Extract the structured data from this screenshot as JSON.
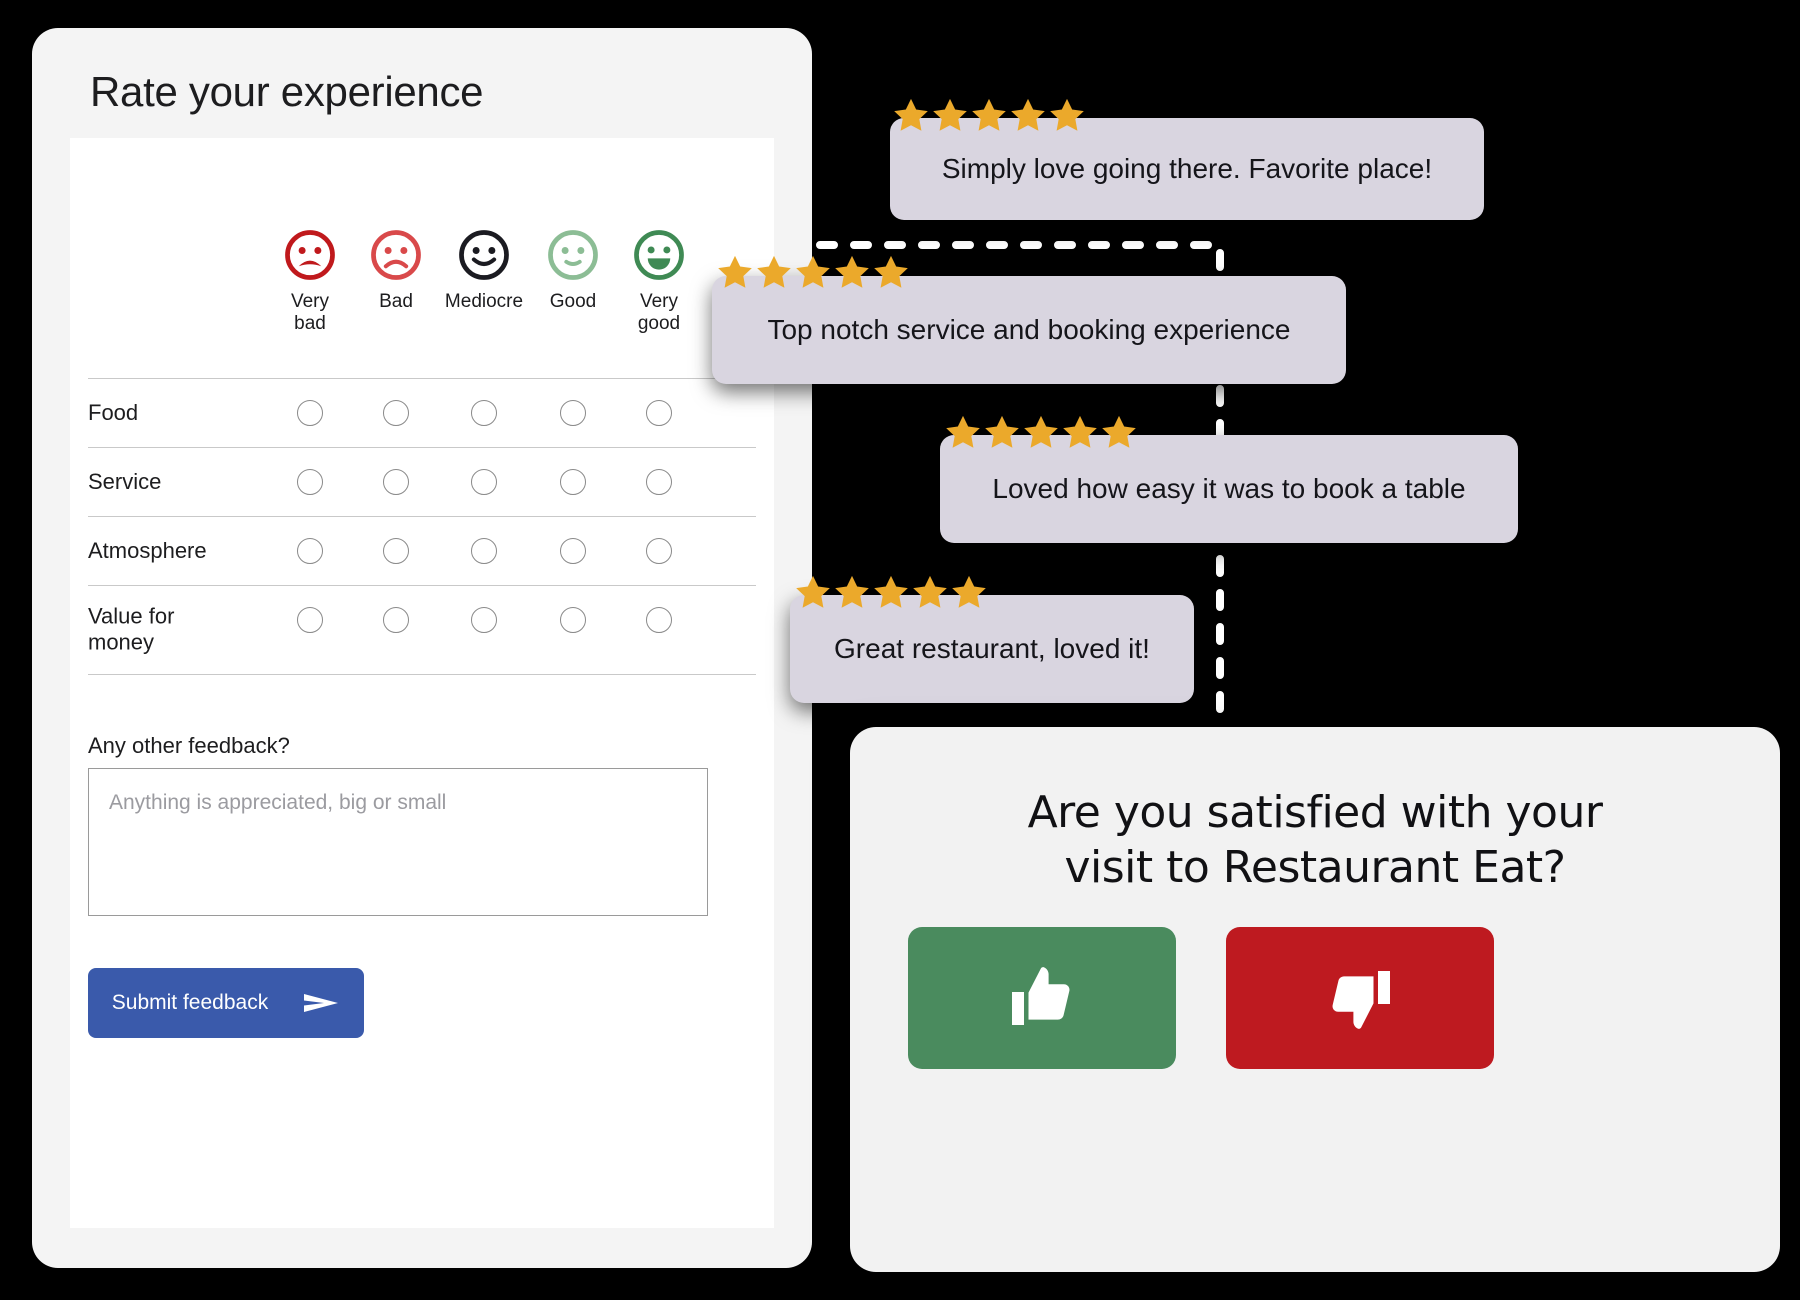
{
  "survey": {
    "title": "Rate your experience",
    "scale": [
      {
        "label": "Very\nbad",
        "label_lines": [
          "Very",
          "bad"
        ],
        "face": "very-sad-face",
        "color": "#c0191c"
      },
      {
        "label": "Bad",
        "label_lines": [
          "Bad"
        ],
        "face": "sad-face",
        "color": "#d9494a"
      },
      {
        "label": "Mediocre",
        "label_lines": [
          "Mediocre"
        ],
        "face": "neutral-smile-face",
        "color": "#1b1b21"
      },
      {
        "label": "Good",
        "label_lines": [
          "Good"
        ],
        "face": "slight-smile-face",
        "color": "#8cbd95"
      },
      {
        "label": "Very\ngood",
        "label_lines": [
          "Very",
          "good"
        ],
        "face": "very-happy-face",
        "color": "#3f8a54"
      }
    ],
    "rows": [
      {
        "label": "Food",
        "label_lines": [
          "Food"
        ]
      },
      {
        "label": "Service",
        "label_lines": [
          "Service"
        ]
      },
      {
        "label": "Atmosphere",
        "label_lines": [
          "Atmosphere"
        ]
      },
      {
        "label": "Value for money",
        "label_lines": [
          "Value for",
          "money"
        ]
      }
    ],
    "feedback_label": "Any other feedback?",
    "feedback_placeholder": "Anything is appreciated, big or small",
    "feedback_value": "",
    "submit_label": "Submit feedback",
    "submit_color": "#3a5aab",
    "send_icon": "send-arrow-icon"
  },
  "reviews": [
    {
      "text": "Simply love going there. Favorite place!",
      "stars": 5,
      "star_icon": "star-icon"
    },
    {
      "text": "Top notch service and booking experience",
      "stars": 5,
      "star_icon": "star-icon"
    },
    {
      "text": "Loved how easy it was to book a table",
      "stars": 5,
      "star_icon": "star-icon"
    },
    {
      "text": "Great restaurant, loved it!",
      "stars": 5,
      "star_icon": "star-icon"
    }
  ],
  "star_color": "#eba92b",
  "card_color": "#d9d5e0",
  "cta": {
    "question_lines": [
      "Are you satisfied with your",
      "visit to Restaurant Eat?"
    ],
    "question": "Are you satisfied with your visit to Restaurant Eat?",
    "yes": {
      "icon": "thumbs-up-icon",
      "color": "#4a8b5e"
    },
    "no": {
      "icon": "thumbs-down-icon",
      "color": "#be1a20"
    }
  }
}
